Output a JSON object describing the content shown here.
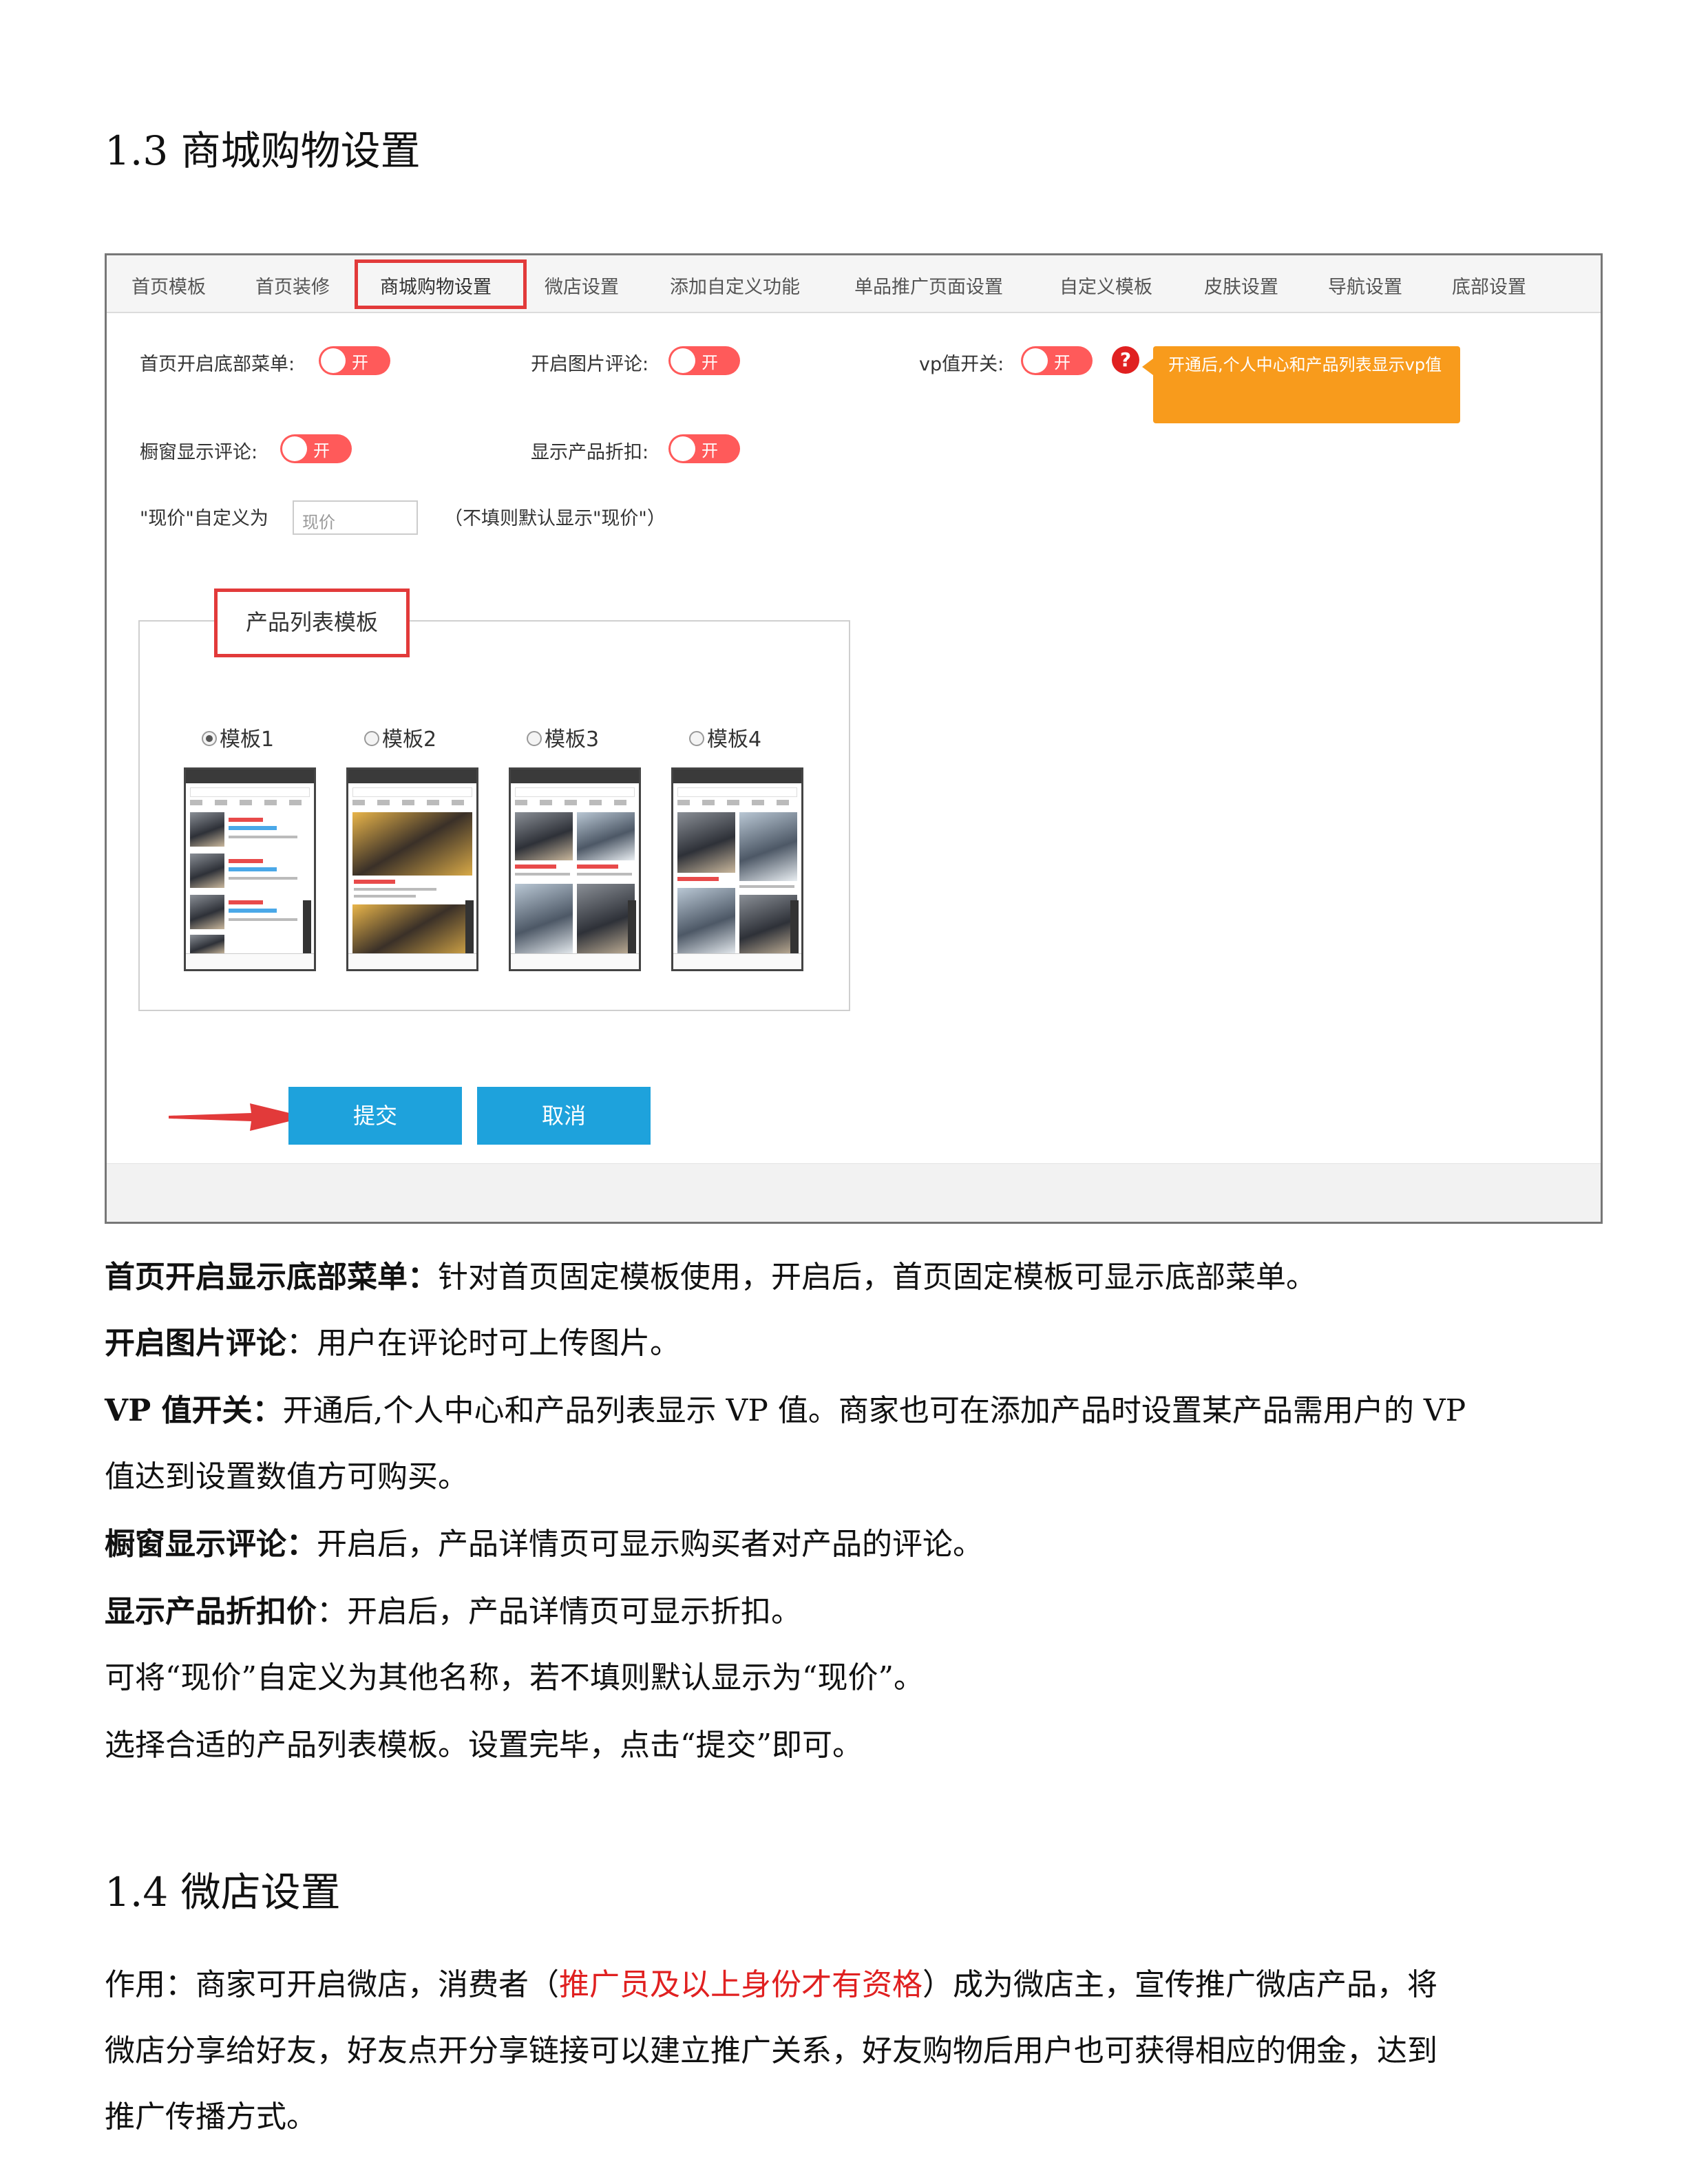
{
  "section_13": {
    "title": "1.3 商城购物设置"
  },
  "tabs": [
    "首页模板",
    "首页装修",
    "商城购物设置",
    "微店设置",
    "添加自定义功能",
    "单品推广页面设置",
    "自定义模板",
    "皮肤设置",
    "导航设置",
    "底部设置"
  ],
  "settings": {
    "bottom_menu_label": "首页开启底部菜单:",
    "image_comment_label": "开启图片评论:",
    "vp_label": "vp值开关:",
    "window_comment_label": "橱窗显示评论:",
    "discount_label": "显示产品折扣:",
    "toggle_text": "开",
    "help_icon": "?",
    "tooltip": "开通后,个人中心和产品列表显示vp值",
    "price_label": "\"现价\"自定义为",
    "price_placeholder": "现价",
    "price_hint": "（不填则默认显示\"现价\"）"
  },
  "template_section": {
    "title": "产品列表模板",
    "options": [
      "模板1",
      "模板2",
      "模板3",
      "模板4"
    ],
    "selected": "模板1"
  },
  "buttons": {
    "submit": "提交",
    "cancel": "取消"
  },
  "description": {
    "p1_bold": "首页开启显示底部菜单：",
    "p1_text": "针对首页固定模板使用，开启后，首页固定模板可显示底部菜单。",
    "p2_bold": "开启图片评论",
    "p2_text": "：用户在评论时可上传图片。",
    "p3_bold": "VP 值开关：",
    "p3_text": "开通后,个人中心和产品列表显示 VP 值。商家也可在添加产品时设置某产品需用户的 VP",
    "p3_line2": "值达到设置数值方可购买。",
    "p4_bold": "橱窗显示评论：",
    "p4_text": "开启后，产品详情页可显示购买者对产品的评论。",
    "p5_bold": "显示产品折扣价",
    "p5_text": "：开启后，产品详情页可显示折扣。",
    "p6": "可将“现价”自定义为其他名称，若不填则默认显示为“现价”。",
    "p7": "选择合适的产品列表模板。设置完毕，点击“提交”即可。"
  },
  "section_14": {
    "title": "1.4 微店设置",
    "line1_a": "作用：商家可开启微店，消费者（",
    "line1_red": "推广员及以上身份才有资格",
    "line1_b": "）成为微店主，宣传推广微店产品，将",
    "line2": "微店分享给好友，好友点开分享链接可以建立推广关系，好友购物后用户也可获得相应的佣金，达到",
    "line3": "推广传播方式。"
  },
  "colors": {
    "toggle": "#ff5a5a",
    "button": "#1ea2dc",
    "highlight_box": "#e23a3a",
    "tooltip": "#f89b1c",
    "red_text": "#e02020"
  }
}
